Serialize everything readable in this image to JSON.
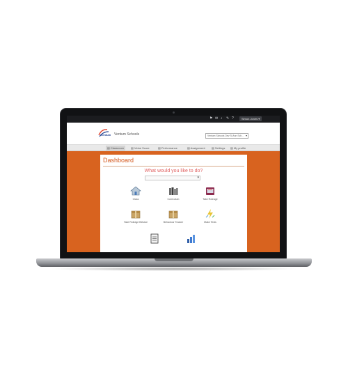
{
  "topbar": {
    "user_label": "Simon Jones ▾"
  },
  "header": {
    "logo_text": "ventum",
    "school_name": "Ventum Schools",
    "school_select_value": "Ventum Schools Dev St Ann Sch..."
  },
  "nav": {
    "items": [
      {
        "label": "Classroom"
      },
      {
        "label": "Vidue Score"
      },
      {
        "label": "Performance"
      },
      {
        "label": "Assignment"
      },
      {
        "label": "Settings"
      },
      {
        "label": "My profile"
      }
    ]
  },
  "dashboard": {
    "title": "Dashboard",
    "question": "What would you like to do?",
    "tiles": [
      {
        "label": "Class",
        "icon": "house-icon"
      },
      {
        "label": "Curriculum",
        "icon": "books-icon"
      },
      {
        "label": "Take Roleage",
        "icon": "folder-icon"
      },
      {
        "label": "Take Roleage Behave",
        "icon": "box-icon"
      },
      {
        "label": "Behaviour Tracker",
        "icon": "box-icon"
      },
      {
        "label": "Make Tests",
        "icon": "lightning-icon"
      },
      {
        "label": "",
        "icon": "notepad-icon"
      },
      {
        "label": "",
        "icon": "chart-icon"
      }
    ]
  },
  "colors": {
    "accent": "#d8631f",
    "title": "#d4581d",
    "question": "#e06060"
  }
}
